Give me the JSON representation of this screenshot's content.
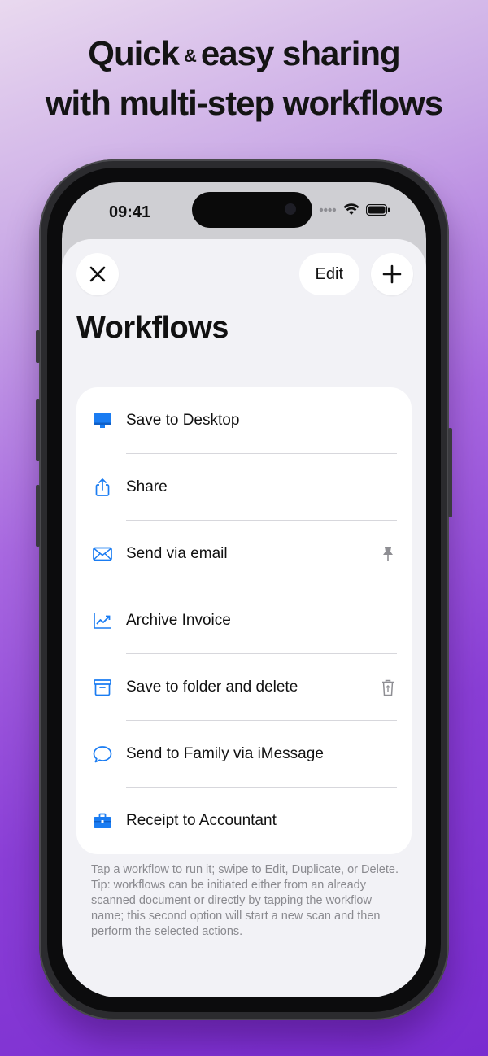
{
  "headline": {
    "line1_a": "Quick",
    "line1_amp": "&",
    "line1_b": "easy sharing",
    "line2": "with multi-step workflows"
  },
  "status_bar": {
    "time": "09:41",
    "icons": [
      "signal-dots-icon",
      "wifi-icon",
      "battery-icon"
    ]
  },
  "toolbar": {
    "close_icon": "close-icon",
    "edit_label": "Edit",
    "add_icon": "plus-icon"
  },
  "page": {
    "title": "Workflows"
  },
  "workflows": [
    {
      "label": "Save to Desktop",
      "icon": "desktop-icon",
      "trailing_icon": null
    },
    {
      "label": "Share",
      "icon": "share-icon",
      "trailing_icon": null
    },
    {
      "label": "Send via email",
      "icon": "envelope-icon",
      "trailing_icon": "pin-icon"
    },
    {
      "label": "Archive Invoice",
      "icon": "chart-trend-icon",
      "trailing_icon": null
    },
    {
      "label": "Save to folder and delete",
      "icon": "archive-box-icon",
      "trailing_icon": "trash-icon"
    },
    {
      "label": "Send to Family via iMessage",
      "icon": "message-bubble-icon",
      "trailing_icon": null
    },
    {
      "label": "Receipt to Accountant",
      "icon": "briefcase-icon",
      "trailing_icon": null
    }
  ],
  "footnote": {
    "line1": "Tap a workflow to run it; swipe to Edit, Duplicate, or Delete.",
    "line2": "Tip: workflows can be initiated either from an already scanned document or directly by tapping the workflow name; this second option will start a new scan and then perform the selected actions."
  },
  "colors": {
    "accent": "#1a7cf2",
    "background_top": "#e9d9ef",
    "background_bottom": "#7a2cd0"
  }
}
